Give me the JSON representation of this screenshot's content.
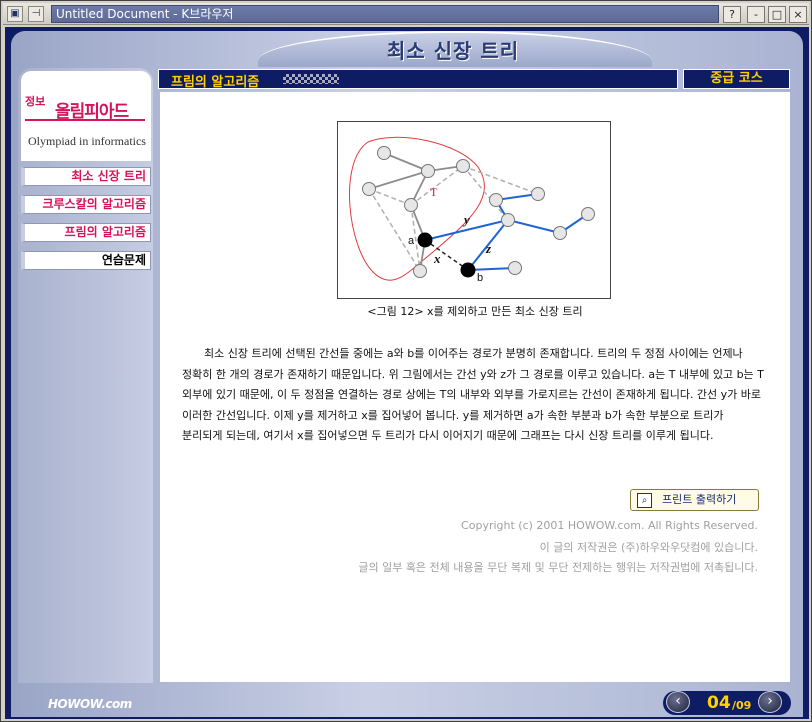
{
  "window": {
    "title": "Untitled Document - K브라우저",
    "help_label": "?",
    "min_label": "-",
    "max_label": "□",
    "close_label": "×"
  },
  "page": {
    "title": "최소 신장 트리",
    "section_label": "프림의 알고리즘",
    "course_label": "중급 코스"
  },
  "logo": {
    "small": "정보",
    "main": "올림피아드",
    "subtitle": "Olympiad in informatics"
  },
  "sidebar": {
    "items": [
      {
        "label": "최소 신장 트리"
      },
      {
        "label": "크루스칼의 알고리즘"
      },
      {
        "label": "프림의 알고리즘"
      },
      {
        "label": "연습문제"
      }
    ]
  },
  "figure": {
    "caption": "<그림 12> x를 제외하고 만든 최소 신장 트리",
    "label_T": "T",
    "label_y": "y",
    "label_a": "a",
    "label_x": "x",
    "label_z": "z",
    "label_b": "b"
  },
  "content": {
    "paragraph": "최소 신장 트리에 선택된 간선들 중에는 a와 b를 이어주는 경로가 분명히 존재합니다. 트리의 두 정점 사이에는 언제나 정확히 한 개의 경로가 존재하기 때문입니다. 위 그림에서는 간선 y와 z가 그 경로를 이루고 있습니다. a는 T 내부에 있고 b는 T 외부에 있기 때문에, 이 두 정점을 연결하는 경로 상에는 T의 내부와 외부를 가로지르는 간선이 존재하게 됩니다. 간선 y가 바로 이러한 간선입니다. 이제 y를 제거하고 x를 집어넣어 봅니다. y를 제거하면 a가 속한 부분과 b가 속한 부분으로 트리가 분리되게 되는데, 여기서 x를 집어넣으면 두 트리가 다시 이어지기 때문에 그래프는 다시 신장 트리를 이루게 됩니다."
  },
  "print_button": {
    "label": "프린트 출력하기",
    "icon": "magnifier-print-icon"
  },
  "copyright": {
    "line1": "Copyright (c) 2001 HOWOW.com. All Rights Reserved.",
    "line2": "이 글의 저작권은 (주)하우와우닷컴에 있습니다.",
    "line3": "글의 일부 혹은 전체 내용을 무단 복제 및 무단 전제하는 행위는 저작권법에 저촉됩니다."
  },
  "footer": {
    "brand": "HOWOW.com",
    "current_page": "04",
    "total_pages": "/09",
    "prev_icon": "chevron-left-icon",
    "next_icon": "chevron-right-icon"
  },
  "colors": {
    "navy": "#0d1c63",
    "accent_pink": "#d4145a",
    "accent_yellow": "#ffd200",
    "edge_blue": "#1e63d8",
    "region_red": "#e23b3b"
  }
}
